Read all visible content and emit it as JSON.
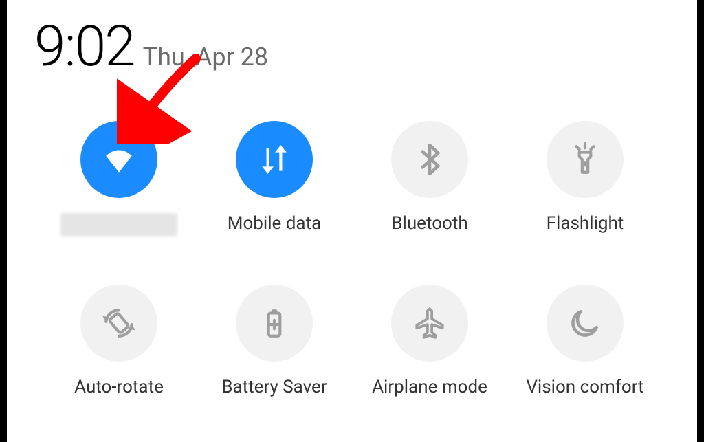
{
  "header": {
    "time": "9:02",
    "date": "Thu, Apr 28"
  },
  "tiles": {
    "wifi": {
      "label": "",
      "active": true
    },
    "mobile_data": {
      "label": "Mobile data",
      "active": true
    },
    "bluetooth": {
      "label": "Bluetooth",
      "active": false
    },
    "flashlight": {
      "label": "Flashlight",
      "active": false
    },
    "auto_rotate": {
      "label": "Auto-rotate",
      "active": false
    },
    "battery_saver": {
      "label": "Battery Saver",
      "active": false
    },
    "airplane_mode": {
      "label": "Airplane mode",
      "active": false
    },
    "vision_comfort": {
      "label": "Vision comfort",
      "active": false
    }
  },
  "colors": {
    "active_bg": "#1a8cff",
    "inactive_bg": "#f1f1f1",
    "active_icon": "#ffffff",
    "inactive_icon": "#9e9e9e",
    "annotation": "#ff0000"
  }
}
